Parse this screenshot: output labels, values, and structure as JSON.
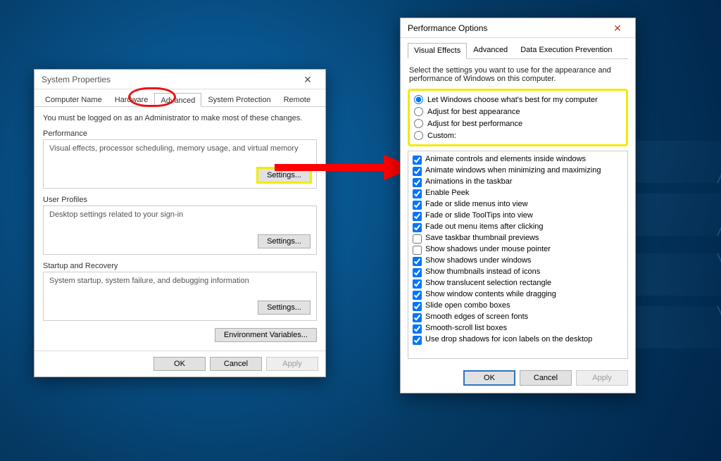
{
  "sysprops": {
    "title": "System Properties",
    "tabs": [
      "Computer Name",
      "Hardware",
      "Advanced",
      "System Protection",
      "Remote"
    ],
    "active_tab_index": 2,
    "admin_note": "You must be logged on as an Administrator to make most of these changes.",
    "groups": {
      "performance": {
        "label": "Performance",
        "desc": "Visual effects, processor scheduling, memory usage, and virtual memory",
        "button": "Settings..."
      },
      "user_profiles": {
        "label": "User Profiles",
        "desc": "Desktop settings related to your sign-in",
        "button": "Settings..."
      },
      "startup_recovery": {
        "label": "Startup and Recovery",
        "desc": "System startup, system failure, and debugging information",
        "button": "Settings..."
      }
    },
    "env_button": "Environment Variables...",
    "footer": {
      "ok": "OK",
      "cancel": "Cancel",
      "apply": "Apply"
    }
  },
  "perfopts": {
    "title": "Performance Options",
    "tabs": [
      "Visual Effects",
      "Advanced",
      "Data Execution Prevention"
    ],
    "active_tab_index": 0,
    "instruction": "Select the settings you want to use for the appearance and performance of Windows on this computer.",
    "radios": [
      {
        "label": "Let Windows choose what's best for my computer",
        "checked": true
      },
      {
        "label": "Adjust for best appearance",
        "checked": false
      },
      {
        "label": "Adjust for best performance",
        "checked": false
      },
      {
        "label": "Custom:",
        "checked": false
      }
    ],
    "options": [
      {
        "label": "Animate controls and elements inside windows",
        "checked": true
      },
      {
        "label": "Animate windows when minimizing and maximizing",
        "checked": true
      },
      {
        "label": "Animations in the taskbar",
        "checked": true
      },
      {
        "label": "Enable Peek",
        "checked": true
      },
      {
        "label": "Fade or slide menus into view",
        "checked": true
      },
      {
        "label": "Fade or slide ToolTips into view",
        "checked": true
      },
      {
        "label": "Fade out menu items after clicking",
        "checked": true
      },
      {
        "label": "Save taskbar thumbnail previews",
        "checked": false
      },
      {
        "label": "Show shadows under mouse pointer",
        "checked": false
      },
      {
        "label": "Show shadows under windows",
        "checked": true
      },
      {
        "label": "Show thumbnails instead of icons",
        "checked": true
      },
      {
        "label": "Show translucent selection rectangle",
        "checked": true
      },
      {
        "label": "Show window contents while dragging",
        "checked": true
      },
      {
        "label": "Slide open combo boxes",
        "checked": true
      },
      {
        "label": "Smooth edges of screen fonts",
        "checked": true
      },
      {
        "label": "Smooth-scroll list boxes",
        "checked": true
      },
      {
        "label": "Use drop shadows for icon labels on the desktop",
        "checked": true
      }
    ],
    "footer": {
      "ok": "OK",
      "cancel": "Cancel",
      "apply": "Apply"
    }
  }
}
